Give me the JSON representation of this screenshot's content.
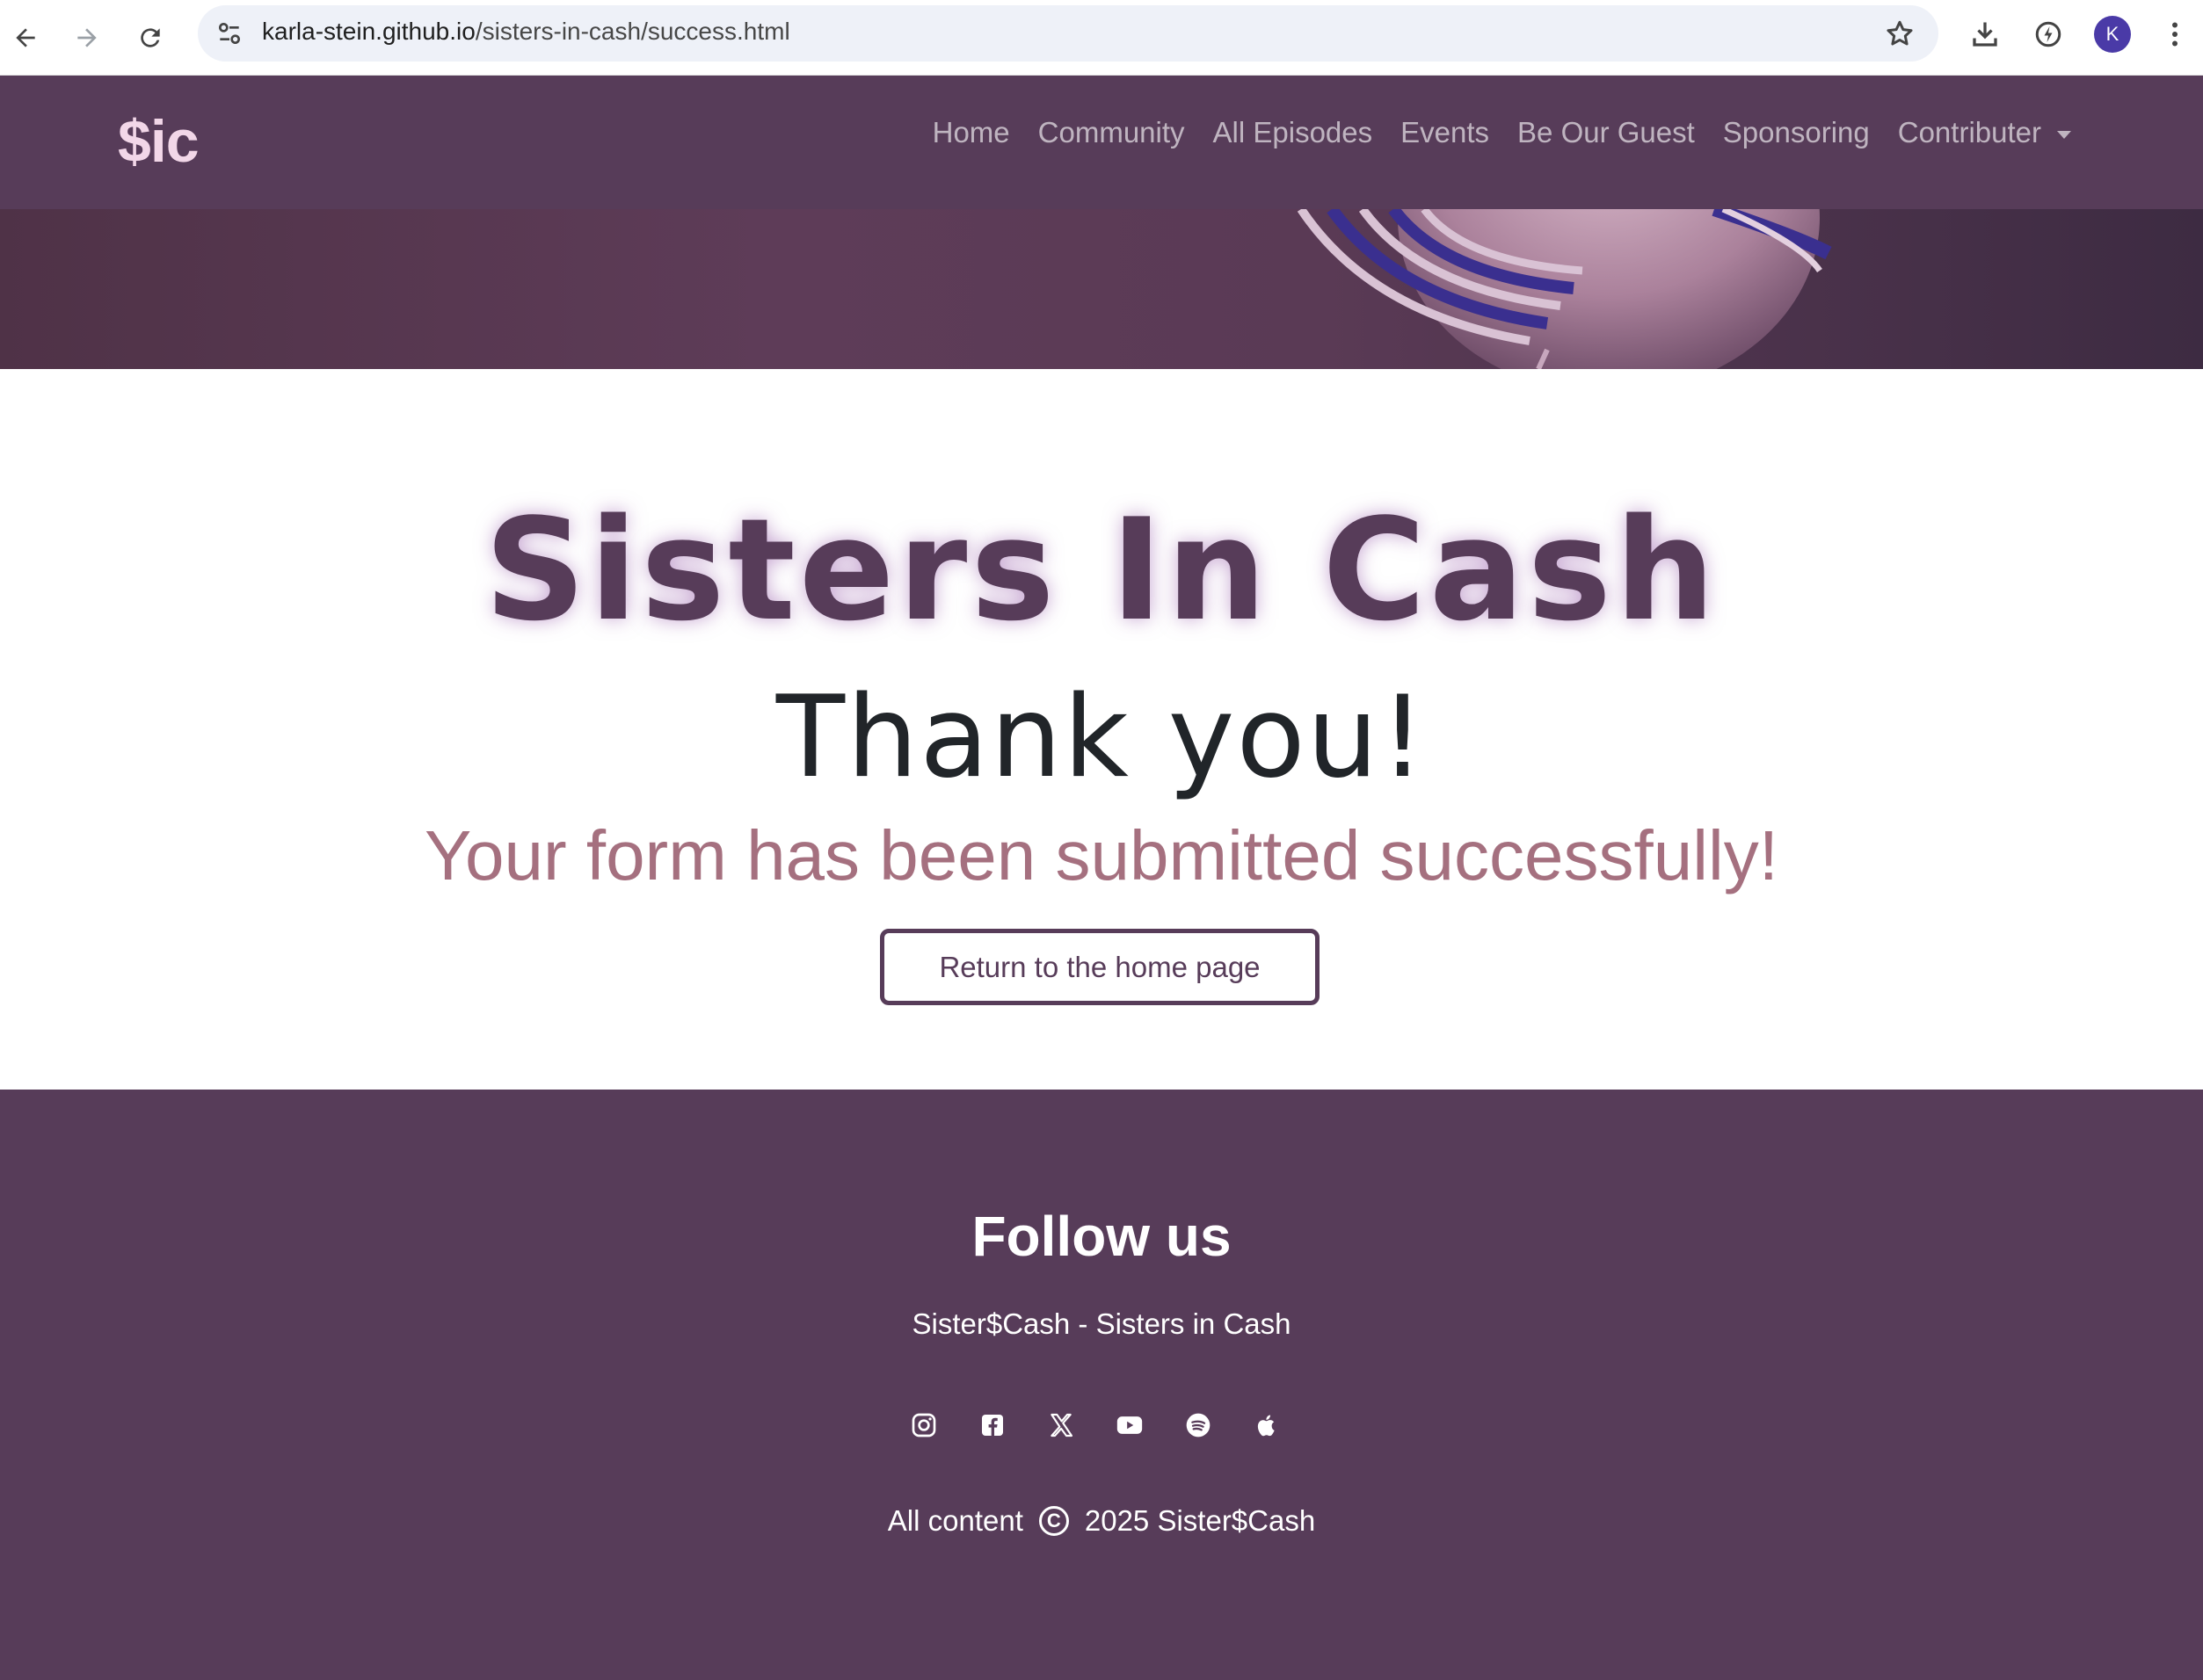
{
  "browser": {
    "url_host": "karla-stein.github.io",
    "url_path": "/sisters-in-cash/success.html",
    "profile_initial": "K",
    "icons": [
      "back-arrow-icon",
      "forward-arrow-icon",
      "reload-icon",
      "site-settings-icon",
      "bookmark-star-icon",
      "download-icon",
      "performance-icon",
      "more-vert-icon"
    ]
  },
  "navbar": {
    "brand": "$ic",
    "links": [
      "Home",
      "Community",
      "All Episodes",
      "Events",
      "Be Our Guest",
      "Sponsoring"
    ],
    "dropdown_label": "Contributer"
  },
  "main": {
    "title": "Sisters In Cash",
    "heading": "Thank you!",
    "message": "Your form has been submitted successfully!",
    "button_label": "Return to the home page"
  },
  "footer": {
    "heading": "Follow us",
    "tagline": "Sister$Cash - Sisters in Cash",
    "social_icons": [
      "instagram-icon",
      "facebook-icon",
      "x-twitter-icon",
      "youtube-icon",
      "spotify-icon",
      "apple-icon"
    ],
    "copyright_prefix": "All content",
    "copyright_suffix": "2025 Sister$Cash"
  },
  "colors": {
    "brand_purple": "#573c59",
    "accent_pink": "#a5707f",
    "brand_light": "#f2d7e8"
  }
}
